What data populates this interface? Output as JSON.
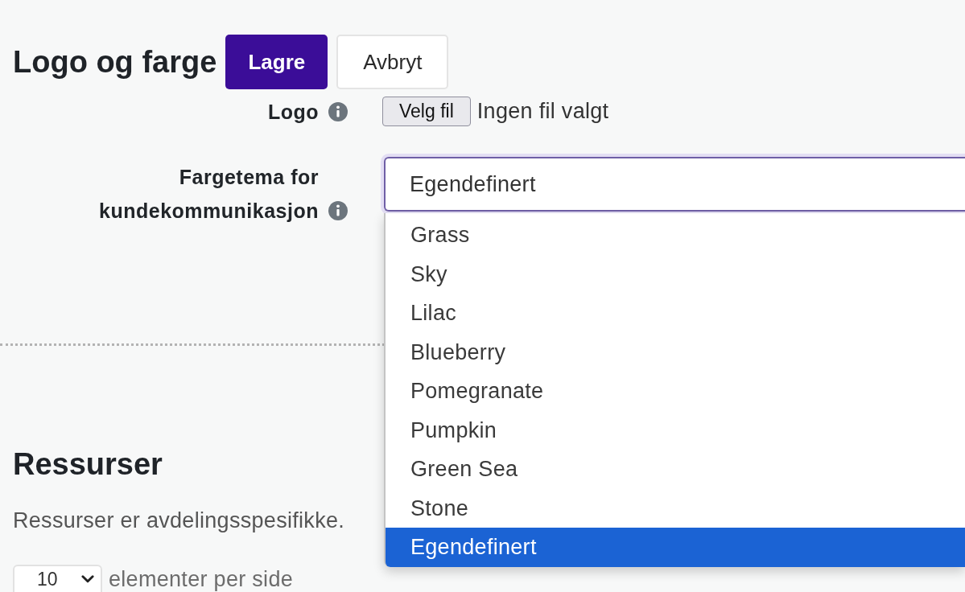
{
  "section": {
    "title": "Logo og farge",
    "buttons": [
      {
        "label": "Lagre",
        "kind": "primary"
      },
      {
        "label": "Avbryt",
        "kind": "secondary"
      }
    ]
  },
  "fields": [
    {
      "kind": "file",
      "label": "Logo",
      "button": "Velg fil",
      "value": "Ingen fil valgt"
    },
    {
      "kind": "select",
      "label": "Fargetema for kundekommunikasjon",
      "value": "Egendefinert",
      "expanded": true,
      "options": [
        {
          "label": "Grass",
          "selected": false
        },
        {
          "label": "Sky",
          "selected": false
        },
        {
          "label": "Lilac",
          "selected": false
        },
        {
          "label": "Blueberry",
          "selected": false
        },
        {
          "label": "Pomegranate",
          "selected": false
        },
        {
          "label": "Pumpkin",
          "selected": false
        },
        {
          "label": "Green Sea",
          "selected": false
        },
        {
          "label": "Stone",
          "selected": false
        },
        {
          "label": "Egendefinert",
          "selected": true
        }
      ]
    }
  ],
  "resources": {
    "title": "Ressurser",
    "description": "Ressurser er avdelingsspesifikke.",
    "page_size": {
      "value": "10",
      "label": "elementer per side"
    }
  }
}
